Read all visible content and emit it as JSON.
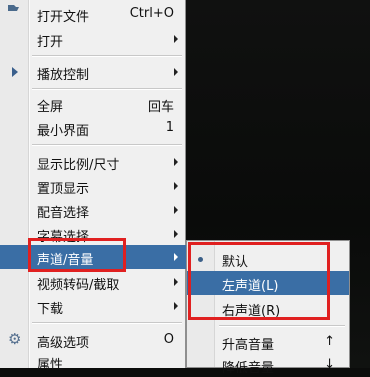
{
  "menu": {
    "items": [
      {
        "label": "打开文件",
        "accel": "Ctrl+O"
      },
      {
        "label": "打开"
      },
      {
        "label": "播放控制"
      },
      {
        "label": "全屏",
        "accel": "回车"
      },
      {
        "label": "最小界面",
        "accel": "1"
      },
      {
        "label": "显示比例/尺寸"
      },
      {
        "label": "置顶显示"
      },
      {
        "label": "配音选择"
      },
      {
        "label": "字幕选择"
      },
      {
        "label": "声道/音量"
      },
      {
        "label": "视频转码/截取"
      },
      {
        "label": "下载"
      },
      {
        "label": "高级选项",
        "accel": "O"
      },
      {
        "label": "属性"
      }
    ]
  },
  "submenu": {
    "items": [
      {
        "label": "默认"
      },
      {
        "label": "左声道(L)"
      },
      {
        "label": "右声道(R)"
      },
      {
        "label": "升高音量",
        "accel": "↑"
      },
      {
        "label": "降低音量",
        "accel": "↓"
      }
    ]
  },
  "colors": {
    "highlight": "#3a6ea5",
    "annotation": "#e02020"
  }
}
